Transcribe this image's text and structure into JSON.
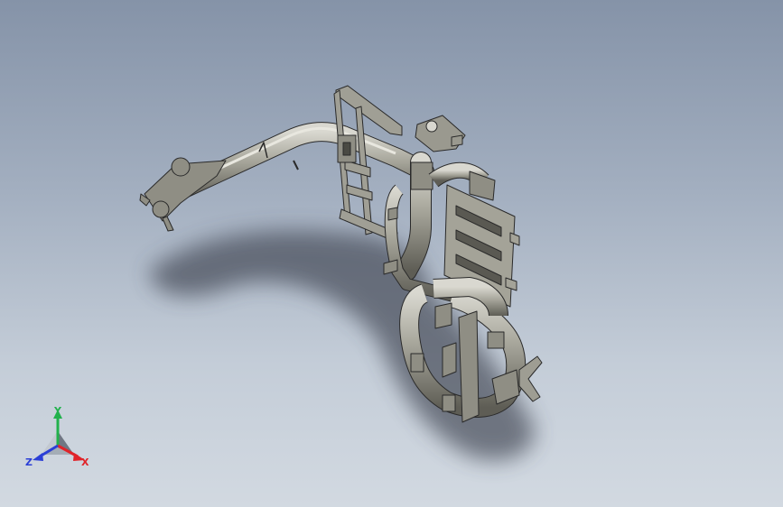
{
  "view": {
    "background_top": "#8593a8",
    "background_bottom": "#d2d9e1",
    "model_color": "#a6a59a",
    "model_edge_color": "#2a2a2a",
    "shadow_color": "#3d4250"
  },
  "triad": {
    "x_label": "X",
    "y_label": "Y",
    "z_label": "Z",
    "x_color": "#e0242a",
    "y_color": "#22b14c",
    "z_color": "#2b3fd6"
  }
}
